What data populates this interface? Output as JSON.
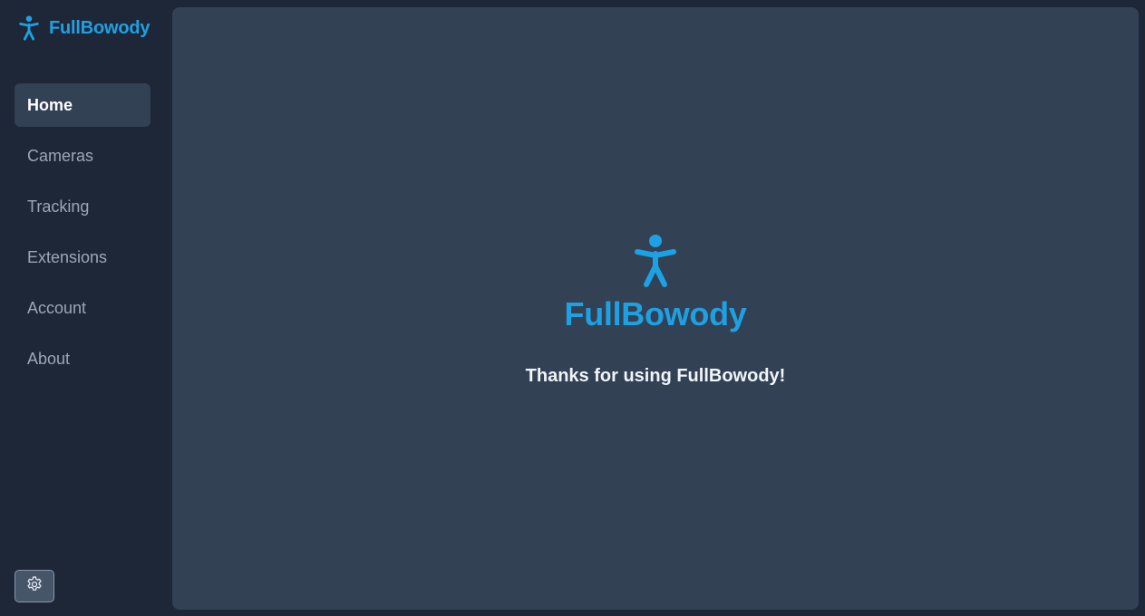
{
  "app": {
    "name": "FullBowody",
    "accent_color": "#1ea1e3"
  },
  "sidebar": {
    "logo_icon": "person-figure-icon",
    "items": [
      {
        "label": "Home",
        "active": true
      },
      {
        "label": "Cameras",
        "active": false
      },
      {
        "label": "Tracking",
        "active": false
      },
      {
        "label": "Extensions",
        "active": false
      },
      {
        "label": "Account",
        "active": false
      },
      {
        "label": "About",
        "active": false
      }
    ],
    "settings_icon": "gear-icon"
  },
  "main": {
    "hero_icon": "person-figure-icon",
    "title": "FullBowody",
    "message": "Thanks for using FullBowody!"
  }
}
